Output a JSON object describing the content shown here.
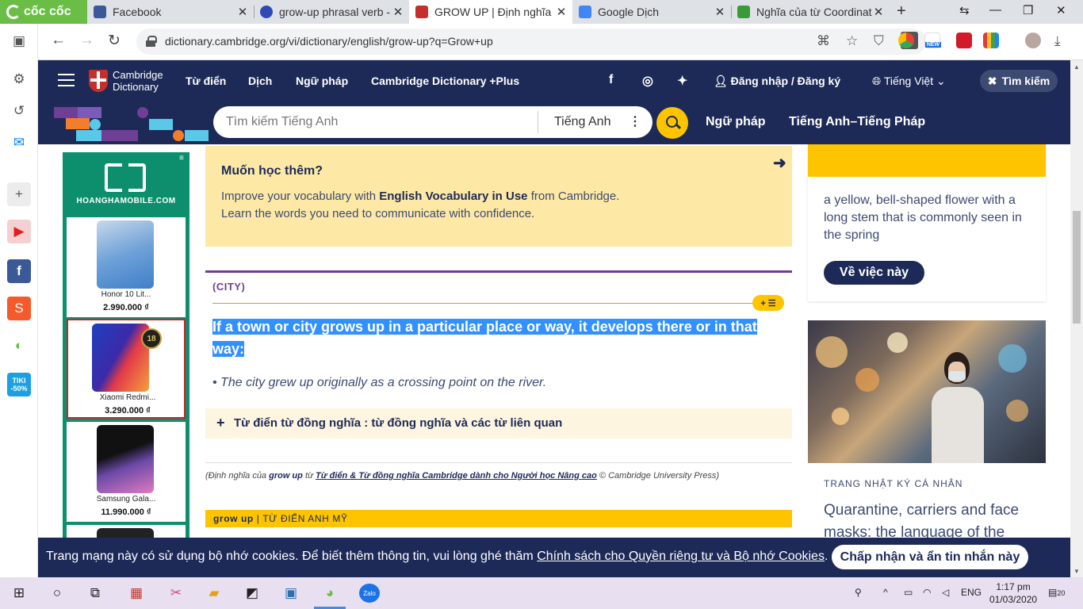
{
  "browser": {
    "brand": "cốc cốc",
    "tabs": [
      {
        "label": "Facebook",
        "color": "#3b5998"
      },
      {
        "label": "grow-up phrasal verb -",
        "color": "#2f4bb3"
      },
      {
        "label": "GROW UP | Định nghĩa",
        "color": "#c52f2b",
        "active": true
      },
      {
        "label": "Google Dịch",
        "color": "#4285f4"
      },
      {
        "label": "Nghĩa của từ Coordinat",
        "color": "#3a9a3a"
      }
    ],
    "url": "dictionary.cambridge.org/vi/dictionary/english/grow-up?q=Grow+up",
    "ext_new_badge": "NEW"
  },
  "header": {
    "logo_line1": "Cambridge",
    "logo_line2": "Dictionary",
    "nav": [
      "Từ điển",
      "Dịch",
      "Ngữ pháp",
      "Cambridge Dictionary +Plus"
    ],
    "login": "Đăng nhập / Đăng ký",
    "language": "Tiếng Việt",
    "search_toggle": "Tìm kiếm"
  },
  "searchbar": {
    "placeholder": "Tìm kiếm Tiếng Anh",
    "dictionary": "Tiếng Anh",
    "links": [
      "Ngữ pháp",
      "Tiếng Anh–Tiếng Pháp"
    ]
  },
  "ad": {
    "brand": "HOANGHAMOBILE.COM",
    "items": [
      {
        "name": "Honor 10 Lit...",
        "price": "2.990.000 ₫"
      },
      {
        "name": "Xiaomi Redmi...",
        "price": "3.290.000 ₫",
        "badge": "18"
      },
      {
        "name": "Samsung Gala...",
        "price": "11.990.000 ₫"
      }
    ]
  },
  "promo": {
    "title": "Muốn học thêm?",
    "line1_pre": "Improve your vocabulary with ",
    "line1_bold": "English Vocabulary in Use",
    "line1_post": " from Cambridge.",
    "line2": "Learn the words you need to communicate with confidence."
  },
  "entry": {
    "guideword": "(CITY)",
    "definition": "If a town or city grows up in a particular place or way, it develops there or in that way:",
    "example": "The city grew up originally as a crossing point on the river.",
    "thesaurus": "Từ điển từ đồng nghĩa : từ đồng nghĩa và các từ liên quan",
    "citation_pre": "(Định nghĩa của ",
    "citation_word": "grow up",
    "citation_mid": " từ ",
    "citation_link": "Từ điển & Từ đồng nghĩa Cambridge dành cho Người học Nâng cao",
    "citation_post": " © Cambridge University Press)",
    "us_word": "grow up",
    "us_label": "| TỪ ĐIỂN ANH MỸ"
  },
  "right": {
    "card_text": "a yellow, bell-shaped flower with a long stem that is commonly seen in the spring",
    "card_button": "Về việc này",
    "blog_category": "TRANG NHẬT KÝ CÁ NHÂN",
    "blog_title": "Quarantine, carriers and face masks: the language of the"
  },
  "cookie": {
    "text": "Trang mạng này có sử dụng bộ nhớ cookies. Để biết thêm thông tin, vui lòng ghé thăm ",
    "link": "Chính sách cho Quyền riêng tư và Bộ nhớ Cookies",
    "button": "Chấp nhận và ẩn tin nhắn này"
  },
  "taskbar": {
    "lang": "ENG",
    "time": "1:17 pm",
    "date": "01/03/2020",
    "notifications": "20"
  },
  "colors": {
    "cambridge_navy": "#1d2a57",
    "cambridge_yellow": "#fec400",
    "selection_blue": "#3390ff",
    "guideword_purple": "#6e3f95"
  }
}
